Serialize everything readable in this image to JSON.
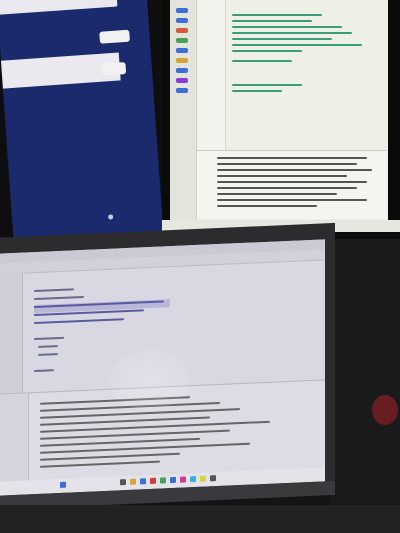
{
  "scene": {
    "description_hidden": "",
    "colors": {
      "left_screen": "#1a2a6c",
      "right_screen": "#eef0e6",
      "laptop_screen": "#d9d7e1",
      "highlight": "#b9b6d8",
      "background": "#141414"
    }
  }
}
